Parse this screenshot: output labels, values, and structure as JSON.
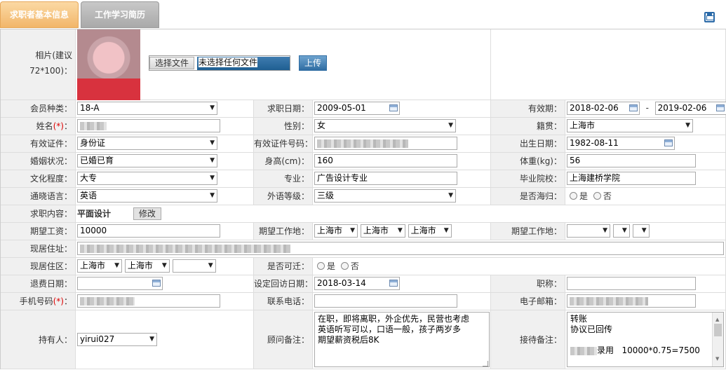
{
  "tabs": [
    {
      "label": "求职者基本信息"
    },
    {
      "label": "工作学习简历"
    }
  ],
  "photo": {
    "label_line1": "相片(建议",
    "label_line2": "72*100)：",
    "choose_label": "选择文件",
    "no_file_label": "未选择任何文件",
    "upload_label": "上传"
  },
  "fields": {
    "member_type": {
      "label": "会员种类：",
      "value": "18-A"
    },
    "apply_date": {
      "label": "求职日期：",
      "value": "2009-05-01"
    },
    "validity": {
      "label": "有效期：",
      "from": "2018-02-06",
      "sep": "-",
      "to": "2019-02-06"
    },
    "name": {
      "label": "姓名",
      "req": "(*)",
      "suffix": "："
    },
    "gender": {
      "label": "性别：",
      "value": "女"
    },
    "native": {
      "label": "籍贯：",
      "value": "上海市"
    },
    "id_type": {
      "label": "有效证件：",
      "value": "身份证"
    },
    "id_number": {
      "label": "有效证件号码："
    },
    "birth": {
      "label": "出生日期：",
      "value": "1982-08-11"
    },
    "marital": {
      "label": "婚姻状况：",
      "value": "已婚已育"
    },
    "height": {
      "label": "身高(cm)：",
      "value": "160"
    },
    "weight": {
      "label": "体重(kg)：",
      "value": "56"
    },
    "education": {
      "label": "文化程度：",
      "value": "大专"
    },
    "major": {
      "label": "专业：",
      "value": "广告设计专业"
    },
    "school": {
      "label": "毕业院校：",
      "value": "上海建桥学院"
    },
    "language": {
      "label": "通晓语言：",
      "value": "英语"
    },
    "lang_level": {
      "label": "外语等级：",
      "value": "三级"
    },
    "overseas": {
      "label": "是否海归：",
      "yes": "是",
      "no": "否"
    },
    "job_content": {
      "label": "求职内容：",
      "value": "平面设计",
      "edit_label": "修改"
    },
    "salary": {
      "label": "期望工资：",
      "value": "10000"
    },
    "work_place1": {
      "label": "期望工作地：",
      "v1": "上海市",
      "v2": "上海市",
      "v3": "上海市"
    },
    "work_place2": {
      "label": "期望工作地："
    },
    "address": {
      "label": "现居住址："
    },
    "district": {
      "label": "现居住区：",
      "v1": "上海市",
      "v2": "上海市"
    },
    "relocate": {
      "label": "是否可迁：",
      "yes": "是",
      "no": "否"
    },
    "refund_date": {
      "label": "退费日期："
    },
    "callback_date": {
      "label": "设定回访日期：",
      "value": "2018-03-14"
    },
    "title": {
      "label": "职称："
    },
    "mobile": {
      "label": "手机号码",
      "req": "(*)",
      "suffix": "："
    },
    "phone": {
      "label": "联系电话："
    },
    "email": {
      "label": "电子邮箱："
    },
    "owner": {
      "label": "持有人：",
      "value": "yirui027"
    },
    "advisor_note": {
      "label": "顾问备注：",
      "text": "在职，即将离职，外企优先，民营也考虑\n英语听写可以，口语一般，孩子两岁多\n期望薪资税后8K"
    },
    "reception_note": {
      "label": "接待备注：",
      "line1": "转账",
      "line2": "协议已回传",
      "line3_suffix": "录用   10000*0.75=7500"
    }
  },
  "colors": {
    "tab_active": "#f2b66a",
    "tab_inactive": "#a9a9a9",
    "label_bg": "#f0f0f0",
    "file_bar": "#1f5f92"
  }
}
